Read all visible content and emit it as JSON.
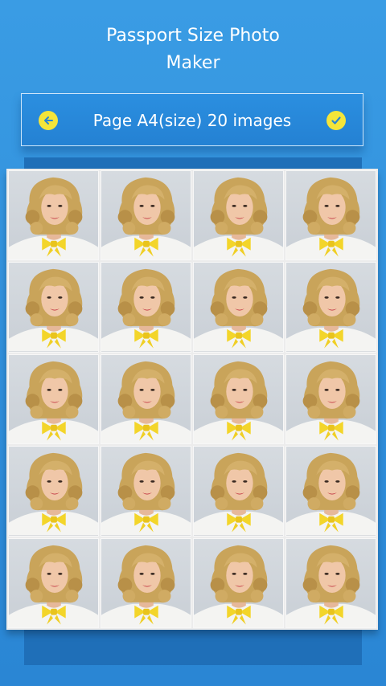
{
  "header": {
    "title_line1": "Passport Size Photo",
    "title_line2": "Maker"
  },
  "toolbar": {
    "back_icon": "arrow-left-icon",
    "label": "Page A4(size) 20 images",
    "confirm_icon": "check-icon",
    "accent_color": "#f5e53a"
  },
  "sheet": {
    "columns": 4,
    "rows": 5,
    "image_count": 20
  }
}
